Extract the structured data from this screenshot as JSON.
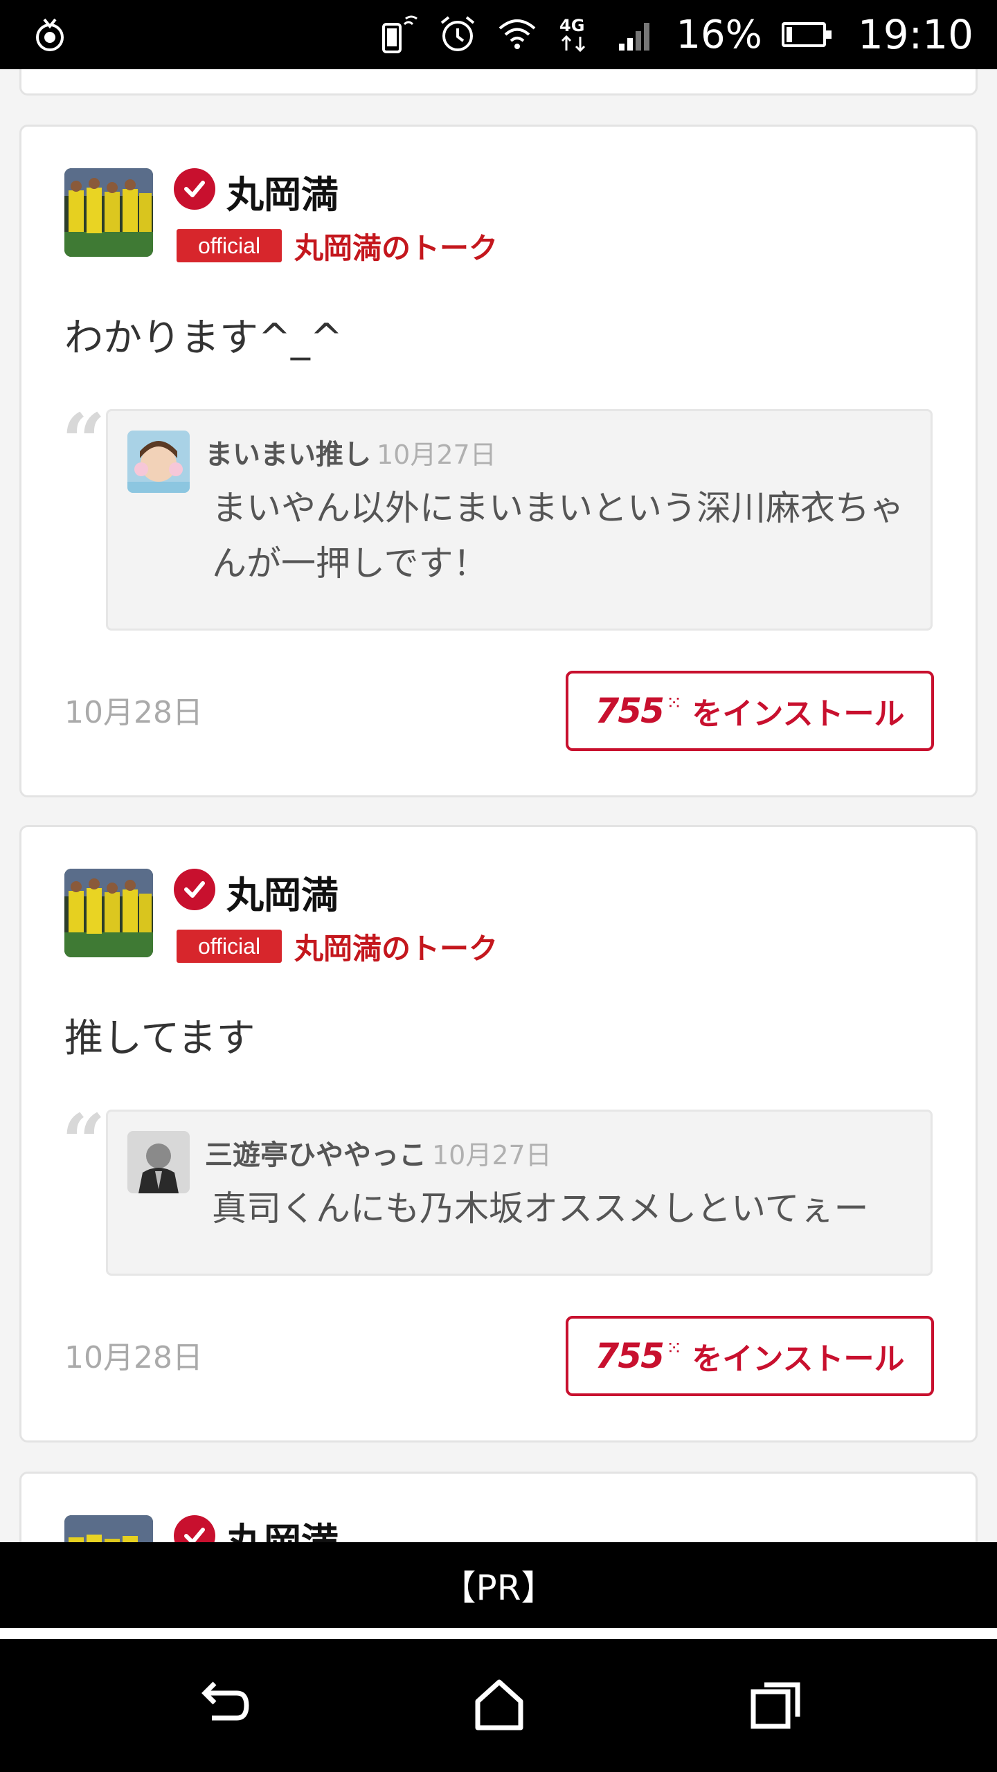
{
  "status_bar": {
    "battery_percent": "16%",
    "battery_level": 0.16,
    "time": "19:10",
    "network": "4G",
    "icons": [
      "notification-icon",
      "vibrate-icon",
      "alarm-icon",
      "wifi-icon",
      "4g-icon",
      "signal-icon",
      "battery-icon"
    ]
  },
  "posts": [
    {
      "author": "丸岡満",
      "official_label": "official",
      "talk_name": "丸岡満のトーク",
      "text": "わかります^_^",
      "quote": {
        "author": "まいまい推し",
        "date": "10月27日",
        "text": "まいやん以外にまいまいという深川麻衣ちゃんが一押しです！"
      },
      "date": "10月28日",
      "install_logo": "755",
      "install_label": "をインストール"
    },
    {
      "author": "丸岡満",
      "official_label": "official",
      "talk_name": "丸岡満のトーク",
      "text": "推してます",
      "quote": {
        "author": "三遊亭ひややっこ",
        "date": "10月27日",
        "text": "真司くんにも乃木坂オススメしといてぇー"
      },
      "date": "10月28日",
      "install_logo": "755",
      "install_label": "をインストール"
    },
    {
      "author": "丸岡満"
    }
  ],
  "pr_bar": {
    "label": "【PR】"
  },
  "nav": {
    "icons": [
      "back-icon",
      "home-icon",
      "recents-icon"
    ]
  },
  "colors": {
    "accent": "#c8102e",
    "official_badge": "#d7262c",
    "talk_link": "#c4171d"
  }
}
